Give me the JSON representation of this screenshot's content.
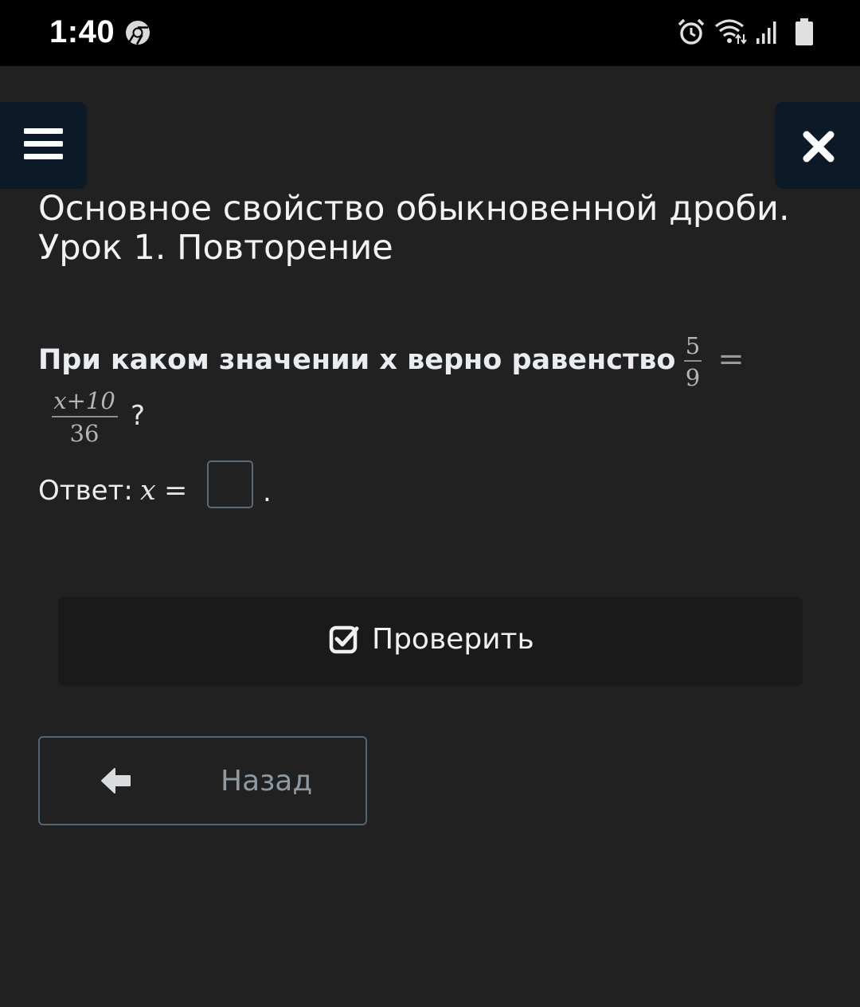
{
  "status_bar": {
    "time": "1:40",
    "icons": [
      "chrome-icon",
      "alarm-icon",
      "wifi-icon",
      "signal-icon",
      "battery-icon"
    ]
  },
  "nav": {
    "menu_icon": "hamburger-menu-icon",
    "close_icon": "close-icon"
  },
  "lesson": {
    "title_line1": "Основное свойство обыкновенной дроби.",
    "title_line2": "Урок 1. Повторение"
  },
  "question": {
    "text": "При каком значении x верно равенство",
    "frac1_num": "5",
    "frac1_den": "9",
    "equals": "=",
    "frac2_num": "x+10",
    "frac2_den": "36",
    "question_mark": "?"
  },
  "answer": {
    "label": "Ответ:",
    "variable": "x",
    "equals": "=",
    "value": "",
    "period": "."
  },
  "actions": {
    "check_label": "Проверить",
    "back_label": "Назад"
  },
  "colors": {
    "background": "#212121",
    "status_bar": "#000000",
    "nav_button": "#0b1a26",
    "check_button": "#1a1a1a",
    "back_border": "#4f6675",
    "back_text": "#8d9aa4"
  }
}
